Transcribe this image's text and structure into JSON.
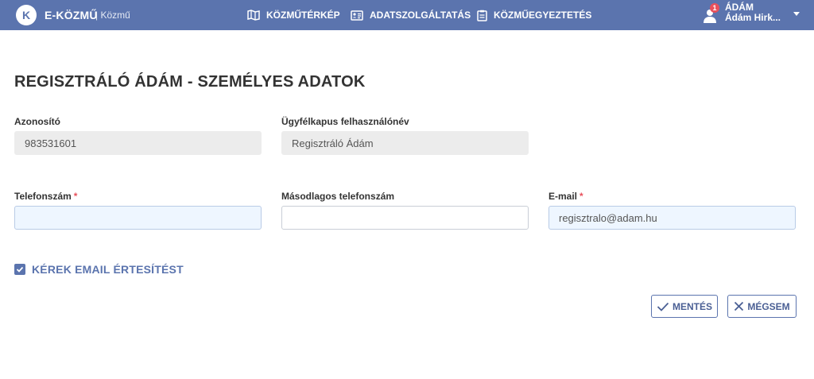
{
  "header": {
    "logo_letter": "K",
    "app_name": "E-KÖZMŰ",
    "app_subtitle": "| Közmű",
    "nav": [
      {
        "label": "KÖZMŰTÉRKÉP",
        "icon": "map-icon"
      },
      {
        "label": "ADATSZOLGÁLTATÁS",
        "icon": "id-card-icon"
      },
      {
        "label": "KÖZMŰEGYEZTETÉS",
        "icon": "clipboard-icon"
      }
    ],
    "user": {
      "notification_count": "1",
      "short_name": "ÁDÁM",
      "full_name": "Ádám Hirk..."
    }
  },
  "page": {
    "title": "REGISZTRÁLÓ ÁDÁM - SZEMÉLYES ADATOK"
  },
  "form": {
    "id": {
      "label": "Azonosító",
      "value": "983531601"
    },
    "gateway_username": {
      "label": "Ügyfélkapus felhasználónév",
      "value": "Regisztráló Ádám"
    },
    "phone": {
      "label": "Telefonszám",
      "required_mark": "*",
      "value": ""
    },
    "secondary_phone": {
      "label": "Másodlagos telefonszám",
      "value": ""
    },
    "email": {
      "label": "E-mail",
      "required_mark": "*",
      "value": "regisztralo@adam.hu"
    },
    "email_notification": {
      "label": "KÉREK EMAIL ÉRTESÍTÉST",
      "checked": true
    }
  },
  "actions": {
    "save_label": "MENTÉS",
    "cancel_label": "MÉGSEM"
  },
  "colors": {
    "header_bg": "#5b74ae",
    "accent": "#5b74ae",
    "required": "#e8505b",
    "badge": "#e8505b"
  }
}
